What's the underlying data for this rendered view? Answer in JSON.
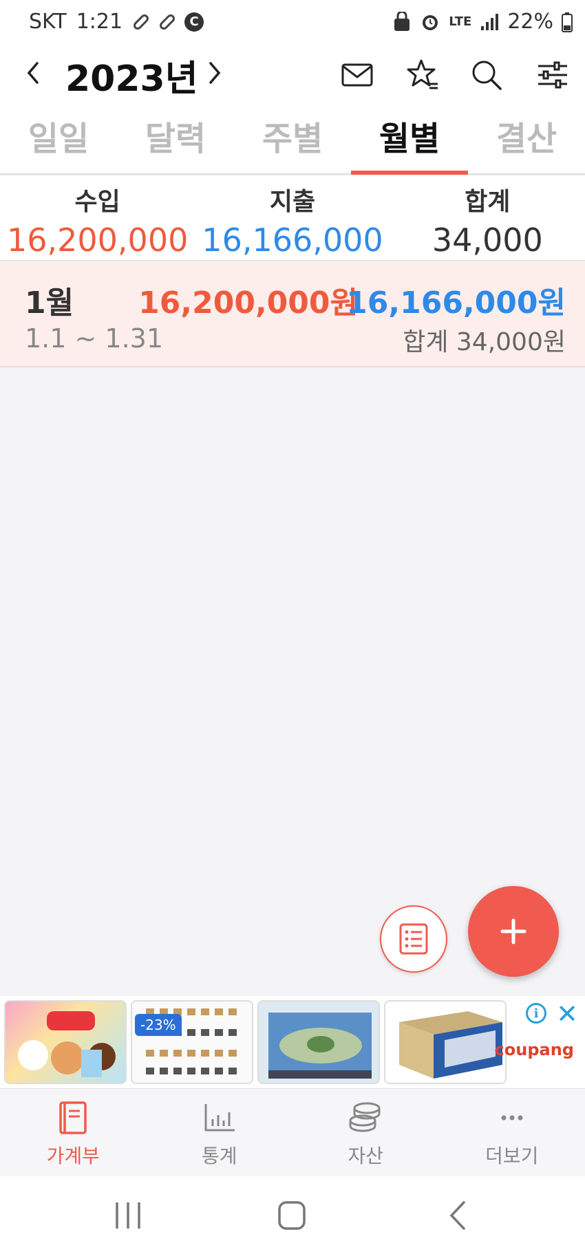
{
  "status_bar": {
    "carrier": "SKT",
    "time": "1:21",
    "network": "LTE",
    "battery": "22%"
  },
  "header": {
    "year": "2023년"
  },
  "tabs": [
    {
      "label": "일일",
      "active": false
    },
    {
      "label": "달력",
      "active": false
    },
    {
      "label": "주별",
      "active": false
    },
    {
      "label": "월별",
      "active": true
    },
    {
      "label": "결산",
      "active": false
    }
  ],
  "summary": {
    "income_label": "수입",
    "income_value": "16,200,000",
    "expense_label": "지출",
    "expense_value": "16,166,000",
    "total_label": "합계",
    "total_value": "34,000"
  },
  "months": [
    {
      "name": "1월",
      "range": "1.1 ~ 1.31",
      "income": "16,200,000원",
      "expense": "16,166,000원",
      "total": "합계 34,000원"
    }
  ],
  "ad": {
    "discount_badge": "-23%",
    "brand": "coupang"
  },
  "bottom_nav": [
    {
      "label": "가계부",
      "active": true
    },
    {
      "label": "통계",
      "active": false
    },
    {
      "label": "자산",
      "active": false
    },
    {
      "label": "더보기",
      "active": false
    }
  ],
  "colors": {
    "accent": "#f05a4f",
    "income": "#f05a3c",
    "expense": "#2e8ae8",
    "month_row_bg": "#fdeeec"
  }
}
